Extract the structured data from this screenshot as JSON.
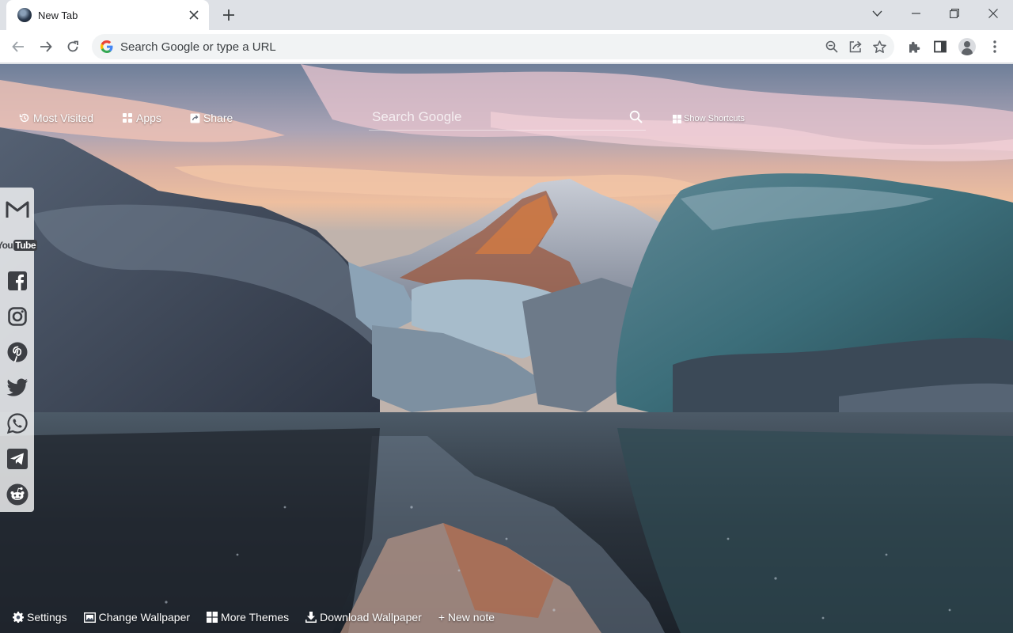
{
  "browser": {
    "tab": {
      "title": "New Tab",
      "favicon": "wallpaper-globe-icon",
      "close_icon": "close-icon"
    },
    "new_tab_icon": "plus-icon",
    "window_controls": [
      "chevron-down-icon",
      "minimize-icon",
      "restore-icon",
      "close-icon"
    ],
    "toolbar": {
      "back_icon": "back-arrow-icon",
      "forward_icon": "forward-arrow-icon",
      "reload_icon": "reload-icon",
      "omnibox_placeholder": "Search Google or type a URL",
      "omnibox_icons": [
        "zoom-icon",
        "share-icon",
        "bookmark-star-icon"
      ],
      "right_icons": [
        "extensions-icon",
        "side-panel-icon",
        "profile-avatar-icon",
        "more-vert-icon"
      ]
    }
  },
  "newtab": {
    "top_links": [
      {
        "label": "Most Visited",
        "icon": "history-icon"
      },
      {
        "label": "Apps",
        "icon": "apps-grid-icon"
      },
      {
        "label": "Share",
        "icon": "share-icon"
      }
    ],
    "search": {
      "placeholder": "Search Google",
      "icon": "search-icon"
    },
    "show_shortcuts": {
      "label": "Show Shortcuts",
      "icon": "grid-icon"
    },
    "social_icons": [
      "gmail-icon",
      "youtube-icon",
      "facebook-icon",
      "instagram-icon",
      "pinterest-icon",
      "twitter-icon",
      "whatsapp-icon",
      "telegram-icon",
      "reddit-icon"
    ],
    "youtube_text": {
      "you": "You",
      "tube": "Tube"
    },
    "bottom_bar": [
      {
        "label": "Settings",
        "icon": "gear-icon"
      },
      {
        "label": "Change Wallpaper",
        "icon": "image-icon"
      },
      {
        "label": "More Themes",
        "icon": "windows-grid-icon"
      },
      {
        "label": "Download Wallpaper",
        "icon": "download-icon"
      },
      {
        "label": "+ New note",
        "icon": ""
      }
    ]
  },
  "colors": {
    "tabstrip": "#dee1e6",
    "toolbar": "#ffffff",
    "omnibox": "#f1f3f4",
    "social_panel": "#ffffffc7"
  }
}
